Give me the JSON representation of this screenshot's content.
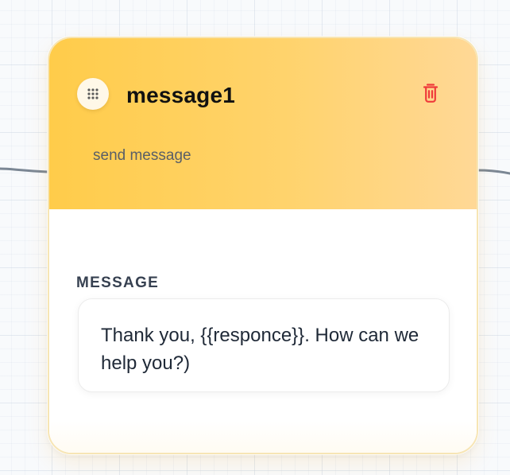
{
  "node": {
    "title": "message1",
    "subtitle": "send message",
    "field_label": "MESSAGE",
    "message_value": "Thank you, {{responce}}. How can we help you?)"
  },
  "colors": {
    "header_start": "#ffcc4a",
    "header_end": "#ffd896",
    "delete_icon": "#ef3b3b",
    "edge": "#7b8794"
  },
  "icons": {
    "drag_handle": "drag-handle-icon",
    "delete": "trash-icon"
  }
}
